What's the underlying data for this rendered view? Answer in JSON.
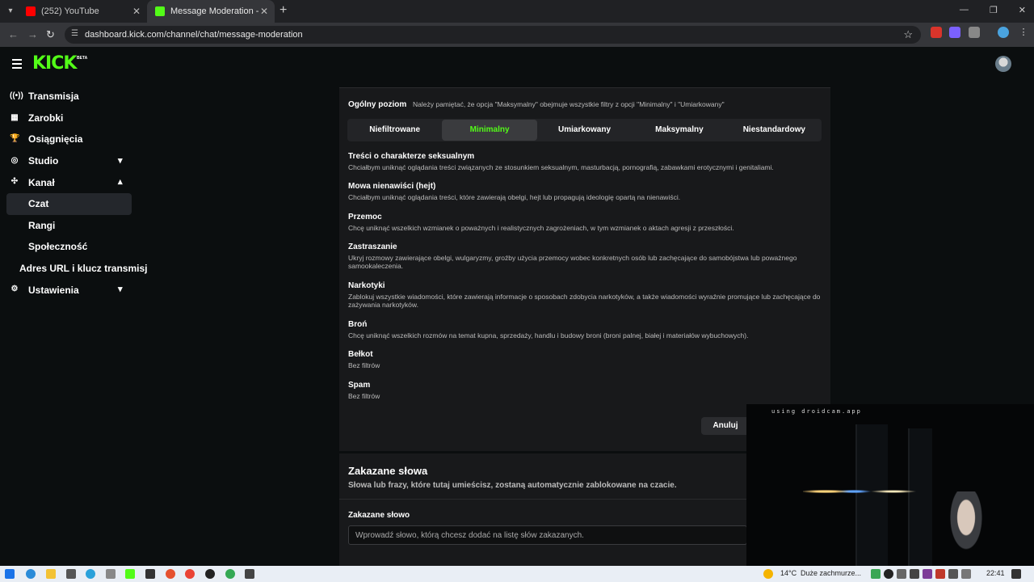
{
  "browser": {
    "tabs": [
      {
        "title": "(252) YouTube",
        "favicon_color": "#ff0000"
      },
      {
        "title": "Message Moderation - Kick Da",
        "favicon_color": "#53fc18"
      }
    ],
    "url": "dashboard.kick.com/channel/chat/message-moderation"
  },
  "brand": {
    "logo": "KICK",
    "badge": "BETA",
    "accent": "#53fc18"
  },
  "sidebar": {
    "items": [
      {
        "label": "Transmisja",
        "icon": "broadcast-icon"
      },
      {
        "label": "Zarobki",
        "icon": "earnings-icon"
      },
      {
        "label": "Osiągnięcia",
        "icon": "trophy-icon"
      },
      {
        "label": "Studio",
        "icon": "studio-icon"
      },
      {
        "label": "Kanał",
        "icon": "channel-icon"
      },
      {
        "label": "Czat"
      },
      {
        "label": "Rangi"
      },
      {
        "label": "Społeczność"
      },
      {
        "label": "Adres URL i klucz transmisj"
      },
      {
        "label": "Ustawienia",
        "icon": "gear-icon"
      }
    ]
  },
  "moderation": {
    "level_label": "Ogólny poziom",
    "level_note": "Należy pamiętać, że opcja \"Maksymalny\" obejmuje wszystkie filtry z opcji \"Minimalny\" i \"Umiarkowany\"",
    "levels": [
      "Niefiltrowane",
      "Minimalny",
      "Umiarkowany",
      "Maksymalny",
      "Niestandardowy"
    ],
    "selected_level": "Minimalny",
    "categories": [
      {
        "title": "Treści o charakterze seksualnym",
        "desc": "Chciałbym uniknąć oglądania treści związanych ze stosunkiem seksualnym, masturbacją, pornografią, zabawkami erotycznymi i genitaliami."
      },
      {
        "title": "Mowa nienawiści (hejt)",
        "desc": "Chciałbym uniknąć oglądania treści, które zawierają obelgi, hejt lub propagują ideologię opartą na nienawiści."
      },
      {
        "title": "Przemoc",
        "desc": "Chcę uniknąć wszelkich wzmianek o poważnych i realistycznych zagrożeniach, w tym wzmianek o aktach agresji z przeszłości."
      },
      {
        "title": "Zastraszanie",
        "desc": "Ukryj rozmowy zawierające obelgi, wulgaryzmy, groźby użycia przemocy wobec konkretnych osób lub zachęcające do samobójstwa lub poważnego samookaleczenia."
      },
      {
        "title": "Narkotyki",
        "desc": "Zablokuj wszystkie wiadomości, które zawierają informacje o sposobach zdobycia narkotyków, a także wiadomości wyraźnie promujące lub zachęcające do zażywania narkotyków."
      },
      {
        "title": "Broń",
        "desc": "Chcę uniknąć wszelkich rozmów na temat kupna, sprzedaży, handlu i budowy broni (broni palnej, białej i materiałów wybuchowych)."
      },
      {
        "title": "Bełkot",
        "desc": "Bez filtrów"
      },
      {
        "title": "Spam",
        "desc": "Bez filtrów"
      }
    ],
    "cancel_label": "Anuluj"
  },
  "forbidden": {
    "title": "Zakazane słowa",
    "desc": "Słowa lub frazy, które tutaj umieścisz, zostaną automatycznie zablokowane na czacie.",
    "field_label": "Zakazane słowo",
    "placeholder": "Wprowadź słowo, którą chcesz dodać na listę słów zakazanych."
  },
  "webcam": {
    "label": "using droidcam.app"
  },
  "taskbar": {
    "weather": "14°C",
    "weather_text": "Duże zachmurze...",
    "clock": "22:41"
  }
}
